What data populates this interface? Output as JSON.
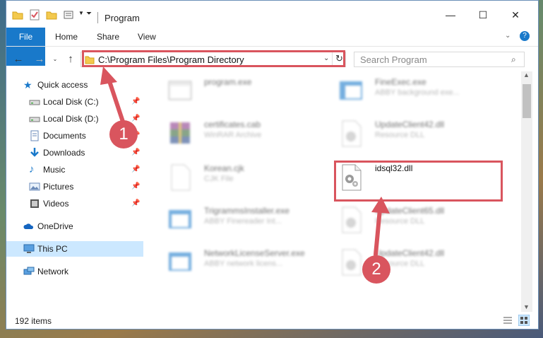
{
  "window": {
    "title": "Program"
  },
  "ribbon": {
    "tabs": [
      "File",
      "Home",
      "Share",
      "View"
    ]
  },
  "nav": {
    "address": "C:\\Program Files\\Program Directory",
    "search_placeholder": "Search Program"
  },
  "sidebar": {
    "items": [
      {
        "label": "Quick access",
        "icon": "star-icon",
        "pinned": false
      },
      {
        "label": "Local Disk (C:)",
        "icon": "drive-icon",
        "pinned": true
      },
      {
        "label": "Local Disk (D:)",
        "icon": "drive-icon",
        "pinned": true
      },
      {
        "label": "Documents",
        "icon": "documents-icon",
        "pinned": true
      },
      {
        "label": "Downloads",
        "icon": "download-icon",
        "pinned": true
      },
      {
        "label": "Music",
        "icon": "music-icon",
        "pinned": true
      },
      {
        "label": "Pictures",
        "icon": "pictures-icon",
        "pinned": true
      },
      {
        "label": "Videos",
        "icon": "videos-icon",
        "pinned": true
      },
      {
        "label": "OneDrive",
        "icon": "cloud-icon",
        "pinned": false
      },
      {
        "label": "This PC",
        "icon": "computer-icon",
        "pinned": false,
        "selected": true
      },
      {
        "label": "Network",
        "icon": "network-icon",
        "pinned": false
      }
    ]
  },
  "files": [
    {
      "name": "program.exe",
      "type": "",
      "icon": "exe-icon"
    },
    {
      "name": "FineExec.exe",
      "type": "ABBY background exe...",
      "icon": "exe-icon"
    },
    {
      "name": "certificates.cab",
      "type": "WinRAR Archive",
      "icon": "winrar-icon"
    },
    {
      "name": "UpdateClient42.dll",
      "type": "Resource DLL",
      "icon": "dll-icon"
    },
    {
      "name": "Korean.cjk",
      "type": "CJK File",
      "icon": "blank-file-icon"
    },
    {
      "name": "idsql32.dll",
      "type": "",
      "icon": "dll-icon"
    },
    {
      "name": "TrigrammsInstaller.exe",
      "type": "ABBY Finereader Int...",
      "icon": "exe-icon"
    },
    {
      "name": "UpdateClient65.dll",
      "type": "Resource DLL",
      "icon": "dll-icon"
    },
    {
      "name": "NetworkLicenseServer.exe",
      "type": "ABBY network licens...",
      "icon": "exe-icon"
    },
    {
      "name": "UpdateClient42.dll",
      "type": "Resource DLL",
      "icon": "dll-icon"
    }
  ],
  "status": {
    "items_count": "192 items"
  },
  "callouts": [
    "1",
    "2"
  ],
  "colors": {
    "accent": "#1979ca",
    "highlight": "#d9555e",
    "selected": "#cce8ff"
  }
}
